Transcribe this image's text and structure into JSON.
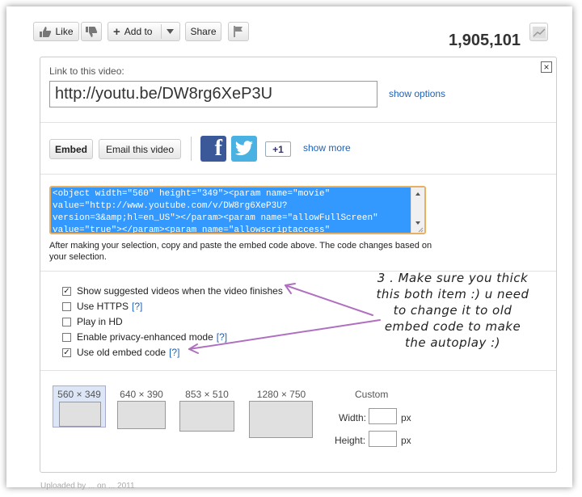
{
  "toolbar": {
    "like_label": "Like",
    "add_label": "Add to",
    "share_label": "Share",
    "view_count": "1,905,101"
  },
  "share_panel": {
    "link_label": "Link to this video:",
    "url_value": "http://youtu.be/DW8rg6XeP3U",
    "show_options": "show options",
    "embed_button": "Embed",
    "email_button": "Email this video",
    "gplus_label": "+1",
    "show_more": "show more",
    "embed_code": "<object width=\"560\" height=\"349\"><param name=\"movie\"\nvalue=\"http://www.youtube.com/v/DW8rg6XeP3U?\nversion=3&amp;hl=en_US\"></param><param name=\"allowFullScreen\"\nvalue=\"true\"></param><param name=\"allowscriptaccess\"",
    "help_text": "After making your selection, copy and paste the embed code above. The code changes based on your selection."
  },
  "options": [
    {
      "label": "Show suggested videos when the video finishes",
      "checked": true,
      "help": ""
    },
    {
      "label": "Use HTTPS",
      "checked": false,
      "help": "[?]"
    },
    {
      "label": "Play in HD",
      "checked": false,
      "help": ""
    },
    {
      "label": "Enable privacy-enhanced mode",
      "checked": false,
      "help": "[?]"
    },
    {
      "label": "Use old embed code",
      "checked": true,
      "help": "[?]"
    }
  ],
  "sizes": [
    {
      "label": "560 × 349",
      "selected": true
    },
    {
      "label": "640 × 390",
      "selected": false
    },
    {
      "label": "853 × 510",
      "selected": false
    },
    {
      "label": "1280 × 750",
      "selected": false
    }
  ],
  "custom": {
    "title": "Custom",
    "width_label": "Width:",
    "height_label": "Height:",
    "unit": "px"
  },
  "annotation": {
    "lines": [
      "3 . Make sure you thick",
      "this both item :) u need",
      "to change it to old",
      "embed code to make",
      "the autoplay :)"
    ],
    "arrow_color": "#b070c0"
  },
  "footer_cut": "Uploaded by ... on ... 2011"
}
